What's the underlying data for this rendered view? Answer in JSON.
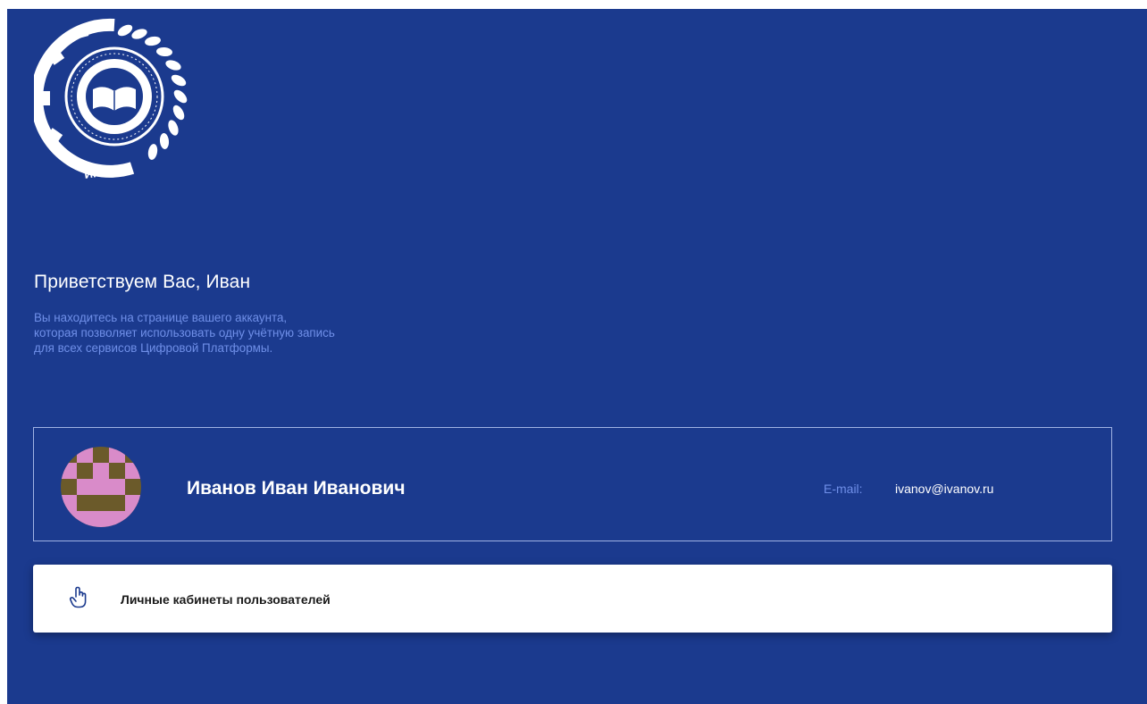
{
  "logo": {
    "icon": "irpo-institute-emblem",
    "text": "ИРПО",
    "ring_text": "ИНСТИТУТ РАЗВИТИЯ ПРОФЕССИОНАЛЬНОГО ОБРАЗОВАНИЯ"
  },
  "greeting": "Приветствуем Вас, Иван",
  "subtitle": {
    "line1": "Вы находитесь на странице вашего аккаунта,",
    "line2": "которая позволяет использовать одну учётную запись",
    "line3": "для всех сервисов Цифровой Платформы."
  },
  "profile": {
    "full_name": "Иванов Иван Иванович",
    "email_label": "E-mail:",
    "email": "ivanov@ivanov.ru",
    "avatar_icon": "pixel-identicon"
  },
  "services": {
    "icon": "hand-pointer-icon",
    "label": "Личные кабинеты пользователей"
  },
  "colors": {
    "background": "#1b3a8e",
    "accent_text": "#6f8fe8",
    "avatar_pink": "#d98bc9",
    "avatar_olive": "#6b5a2a"
  }
}
